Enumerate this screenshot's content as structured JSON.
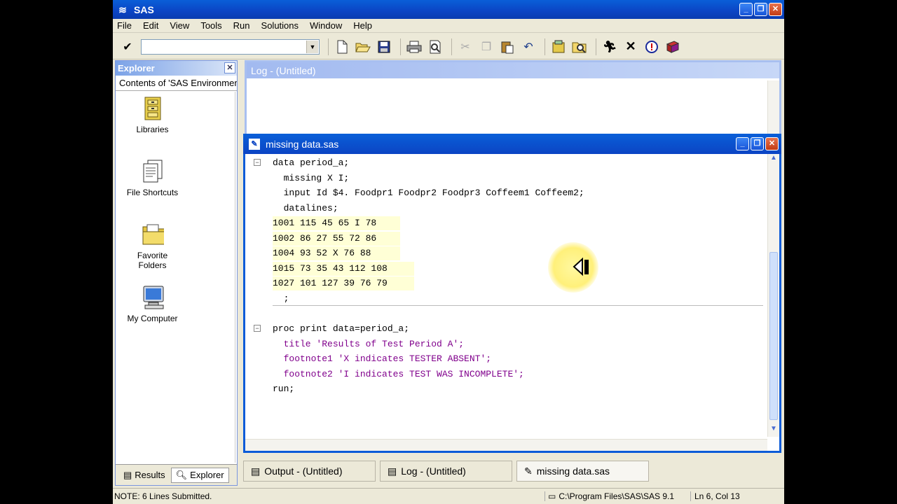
{
  "app": {
    "title": "SAS",
    "icon": "sas-logo-icon"
  },
  "menu": [
    "File",
    "Edit",
    "View",
    "Tools",
    "Run",
    "Solutions",
    "Window",
    "Help"
  ],
  "toolbar": {
    "command_value": "",
    "icons": [
      "check-icon",
      "new-icon",
      "open-icon",
      "save-icon",
      "print-icon",
      "print-preview-icon",
      "cut-icon",
      "copy-icon",
      "paste-icon",
      "undo-icon",
      "libraries-icon",
      "explorer-icon",
      "run-icon",
      "clear-icon",
      "break-icon",
      "help-icon"
    ]
  },
  "explorer": {
    "title": "Explorer",
    "contents_label": "Contents of 'SAS Environment'",
    "items": [
      {
        "label": "Libraries",
        "icon": "cabinet-icon"
      },
      {
        "label": "File Shortcuts",
        "icon": "shortcuts-icon"
      },
      {
        "label": "Favorite Folders",
        "icon": "folder-icon"
      },
      {
        "label": "My Computer",
        "icon": "computer-icon"
      }
    ],
    "tabs": [
      {
        "label": "Results",
        "icon": "results-icon"
      },
      {
        "label": "Explorer",
        "icon": "explorer-icon"
      }
    ]
  },
  "log_window": {
    "title": "Log - (Untitled)"
  },
  "editor": {
    "title": "missing data.sas",
    "lines": [
      "data period_a;",
      "  missing X I;",
      "  input Id $4. Foodpr1 Foodpr2 Foodpr3 Coffeem1 Coffeem2;",
      "  datalines;",
      "1001 115 45 65 I 78",
      "1002 86 27 55 72 86",
      "1004 93 52 X 76 88",
      "1015 73 35 43 112 108",
      "1027 101 127 39 76 79",
      "  ;",
      "",
      "proc print data=period_a;",
      "  title 'Results of Test Period A';",
      "  footnote1 'X indicates TESTER ABSENT';",
      "  footnote2 'I indicates TEST WAS INCOMPLETE';",
      "run;"
    ]
  },
  "tasks": [
    {
      "label": "Output - (Untitled)",
      "icon": "output-icon"
    },
    {
      "label": "Log - (Untitled)",
      "icon": "log-icon"
    },
    {
      "label": "missing data.sas",
      "icon": "program-icon"
    }
  ],
  "status": {
    "message": "NOTE:  6 Lines Submitted.",
    "path": "C:\\Program Files\\SAS\\SAS 9.1",
    "position": "Ln 6, Col 13"
  }
}
